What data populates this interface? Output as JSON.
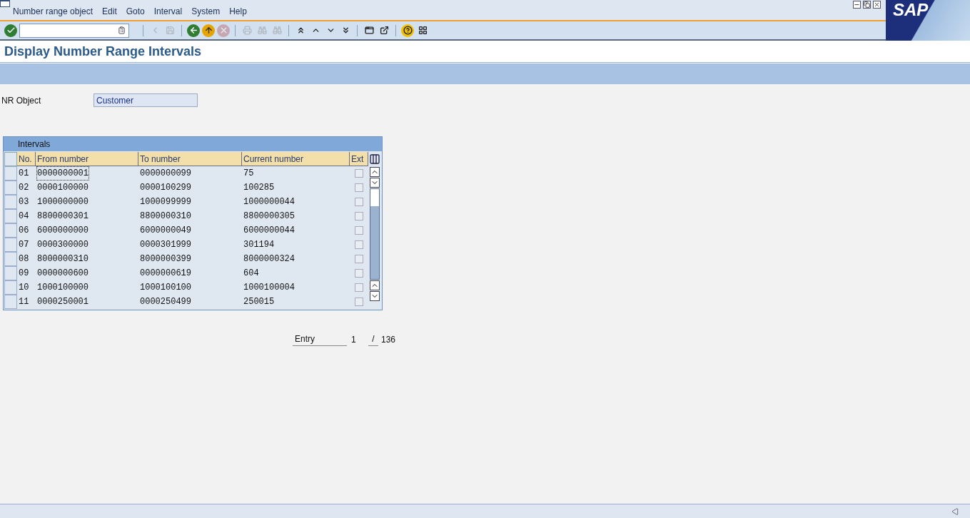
{
  "menu": [
    "Number range object",
    "Edit",
    "Goto",
    "Interval",
    "System",
    "Help"
  ],
  "toolbar": [
    {
      "kind": "enter",
      "disabled": false
    },
    {
      "kind": "field"
    },
    {
      "kind": "sep"
    },
    {
      "kind": "prev",
      "disabled": true
    },
    {
      "kind": "save",
      "disabled": true
    },
    {
      "kind": "sep"
    },
    {
      "kind": "back",
      "disabled": false
    },
    {
      "kind": "exit",
      "disabled": false
    },
    {
      "kind": "cancel",
      "disabled": true
    },
    {
      "kind": "sep"
    },
    {
      "kind": "print",
      "disabled": true
    },
    {
      "kind": "find",
      "disabled": true
    },
    {
      "kind": "findnext",
      "disabled": true
    },
    {
      "kind": "sep"
    },
    {
      "kind": "first",
      "disabled": false
    },
    {
      "kind": "pageup",
      "disabled": false
    },
    {
      "kind": "pagedown",
      "disabled": false
    },
    {
      "kind": "last",
      "disabled": false
    },
    {
      "kind": "sep"
    },
    {
      "kind": "session",
      "disabled": false
    },
    {
      "kind": "shortcut",
      "disabled": false
    },
    {
      "kind": "sep"
    },
    {
      "kind": "help",
      "disabled": false
    },
    {
      "kind": "layout",
      "disabled": false
    }
  ],
  "logo": "SAP",
  "title": "Display Number Range Intervals",
  "nr_object": {
    "label": "NR Object",
    "value": "Customer"
  },
  "table": {
    "title": "Intervals",
    "columns": [
      "No.",
      "From number",
      "To number",
      "Current number",
      "Ext"
    ],
    "rows": [
      {
        "no": "01",
        "from": "0000000001",
        "to": "0000000099",
        "current": "75",
        "ext": false,
        "focused": true
      },
      {
        "no": "02",
        "from": "0000100000",
        "to": "0000100299",
        "current": "100285",
        "ext": false,
        "focused": false
      },
      {
        "no": "03",
        "from": "1000000000",
        "to": "1000099999",
        "current": "1000000044",
        "ext": false,
        "focused": false
      },
      {
        "no": "04",
        "from": "8800000301",
        "to": "8800000310",
        "current": "8800000305",
        "ext": false,
        "focused": false
      },
      {
        "no": "06",
        "from": "6000000000",
        "to": "6000000049",
        "current": "6000000044",
        "ext": false,
        "focused": false
      },
      {
        "no": "07",
        "from": "0000300000",
        "to": "0000301999",
        "current": "301194",
        "ext": false,
        "focused": false
      },
      {
        "no": "08",
        "from": "8000000310",
        "to": "8000000399",
        "current": "8000000324",
        "ext": false,
        "focused": false
      },
      {
        "no": "09",
        "from": "0000000600",
        "to": "0000000619",
        "current": "604",
        "ext": false,
        "focused": false
      },
      {
        "no": "10",
        "from": "1000100000",
        "to": "1000100100",
        "current": "1000100004",
        "ext": false,
        "focused": false
      },
      {
        "no": "11",
        "from": "0000250001",
        "to": "0000250499",
        "current": "250015",
        "ext": false,
        "focused": false
      }
    ]
  },
  "entry": {
    "label": "Entry",
    "value": "1",
    "separator": "/",
    "total": "136"
  }
}
